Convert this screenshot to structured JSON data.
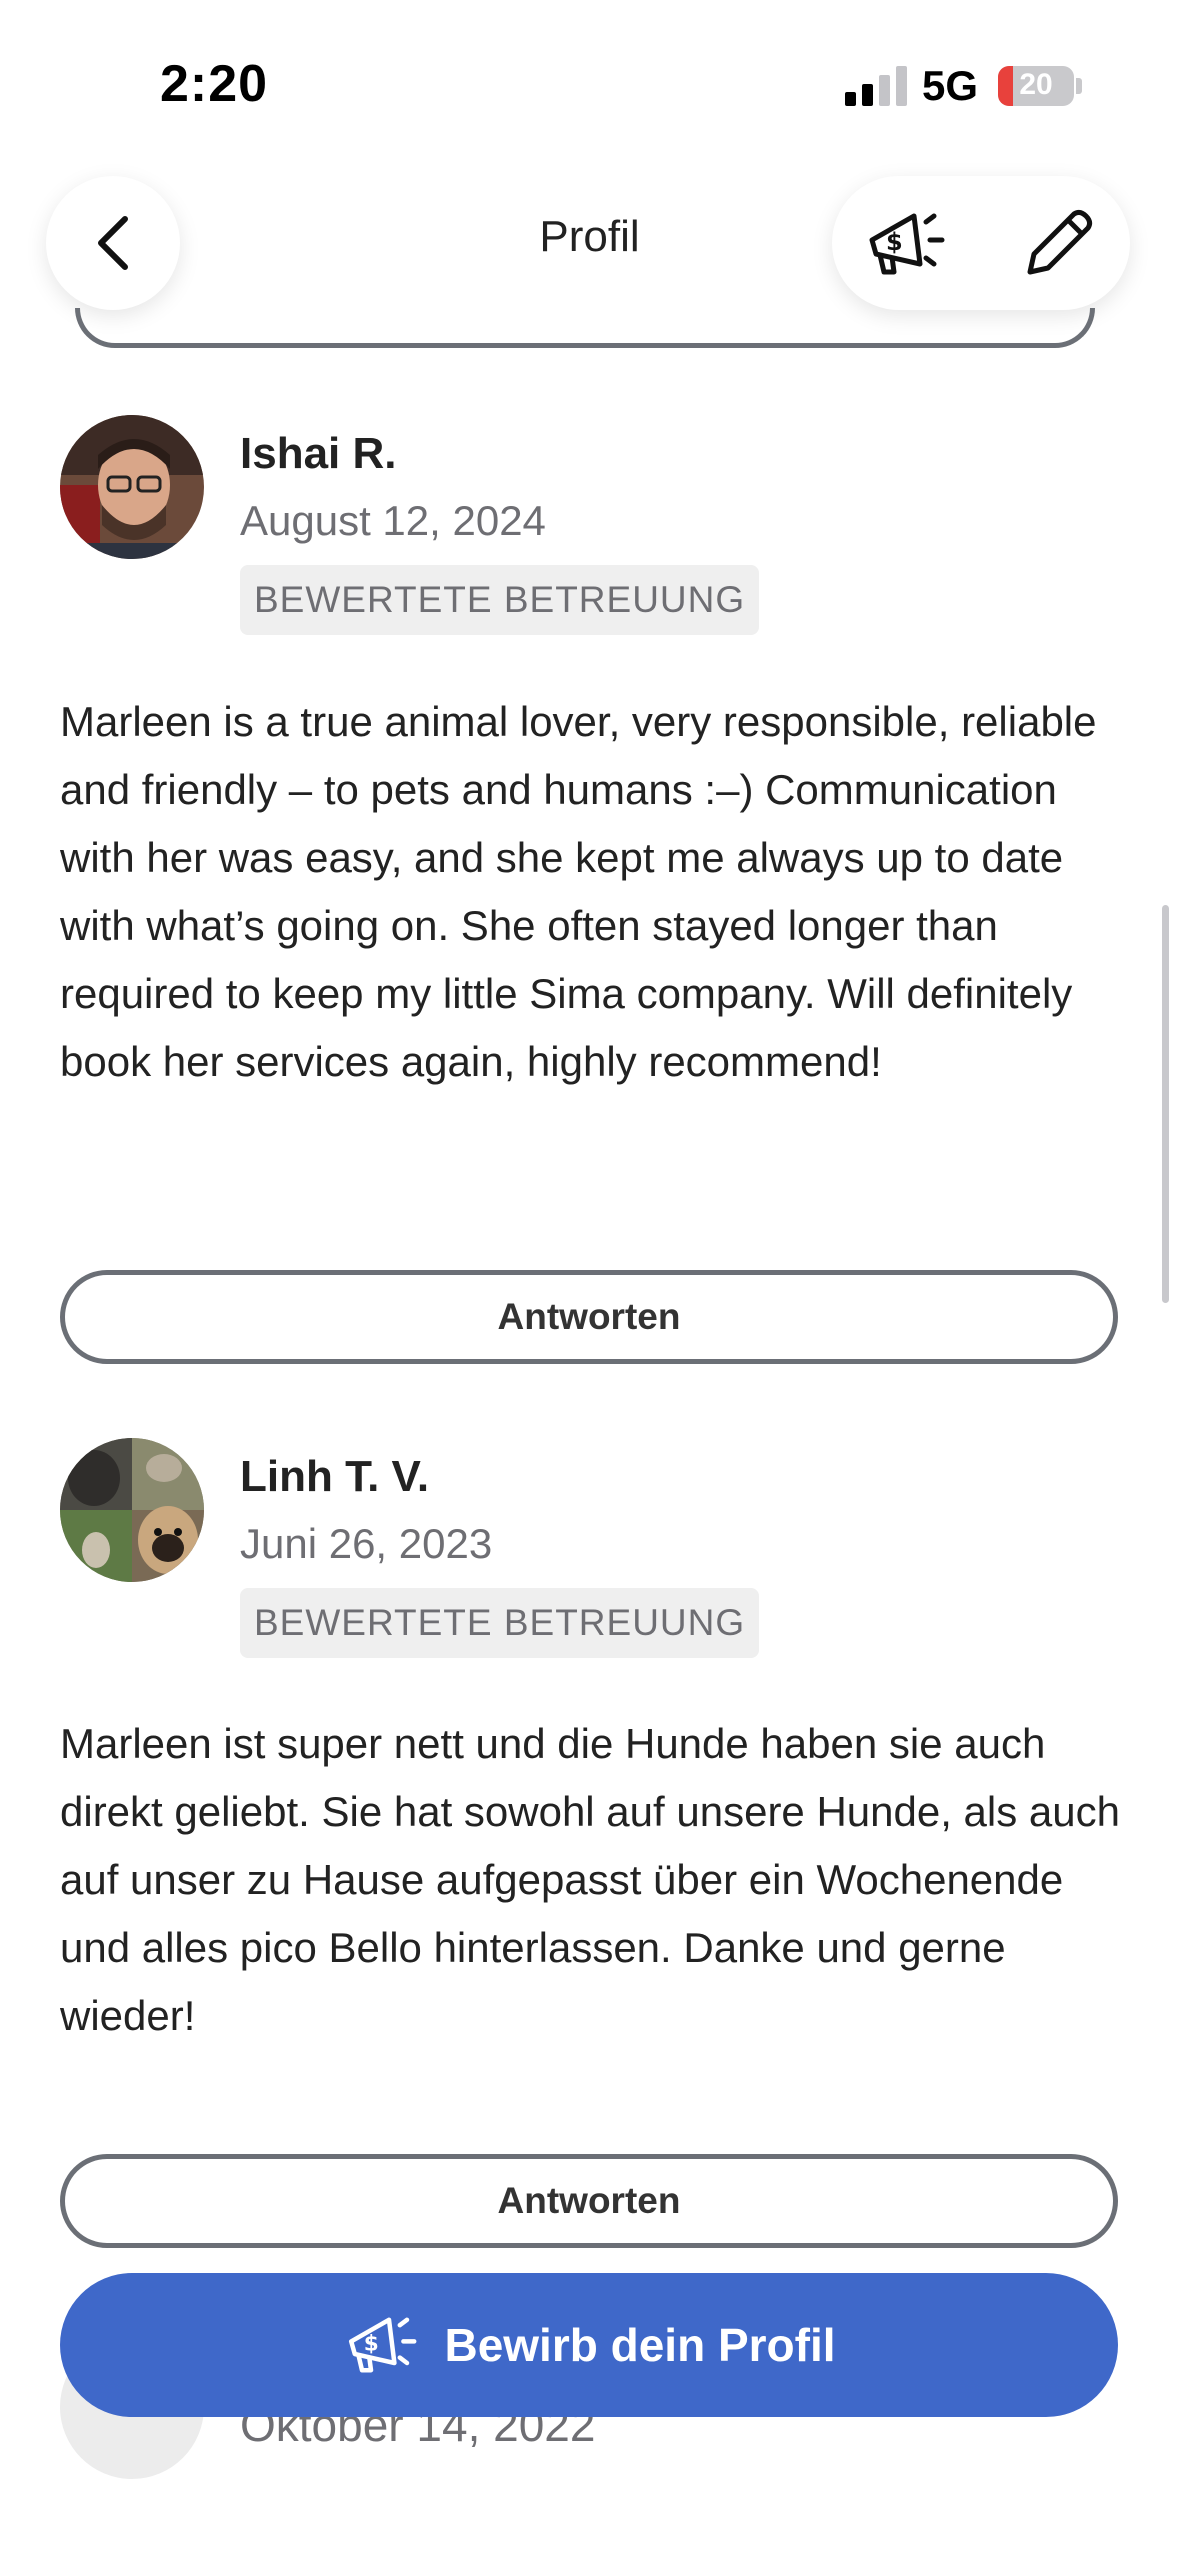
{
  "status_bar": {
    "time": "2:20",
    "network": "5G",
    "battery": "20"
  },
  "nav": {
    "title": "Profil"
  },
  "reviews": [
    {
      "name": "Ishai R.",
      "date": "August 12, 2024",
      "badge": "BEWERTETE BETREUUNG",
      "text": "Marleen is a true animal lover, very responsible, reliable and friendly – to pets and humans :–) Communication with her was easy, and she kept me always up to date with what’s going on. She often stayed longer than required to keep my little Sima company. Will definitely book her services again, highly recommend!",
      "reply_label": "Antworten"
    },
    {
      "name": "Linh T. V.",
      "date": "Juni 26, 2023",
      "badge": "BEWERTETE BETREUUNG",
      "text": "Marleen ist super nett und die Hunde haben sie auch direkt geliebt. Sie hat sowohl auf unsere Hunde, als auch auf unser zu Hause aufgepasst über ein Wochenende und alles pico Bello hinterlassen. Danke und gerne wieder!",
      "reply_label": "Antworten"
    },
    {
      "date": "Oktober 14, 2022"
    }
  ],
  "promote_button": {
    "label": "Bewirb dein Profil"
  },
  "icons": {
    "back": "chevron-left-icon",
    "promote": "megaphone-dollar-icon",
    "edit": "pencil-icon"
  },
  "colors": {
    "accent": "#3f68c9",
    "battery_low": "#e8413c"
  }
}
